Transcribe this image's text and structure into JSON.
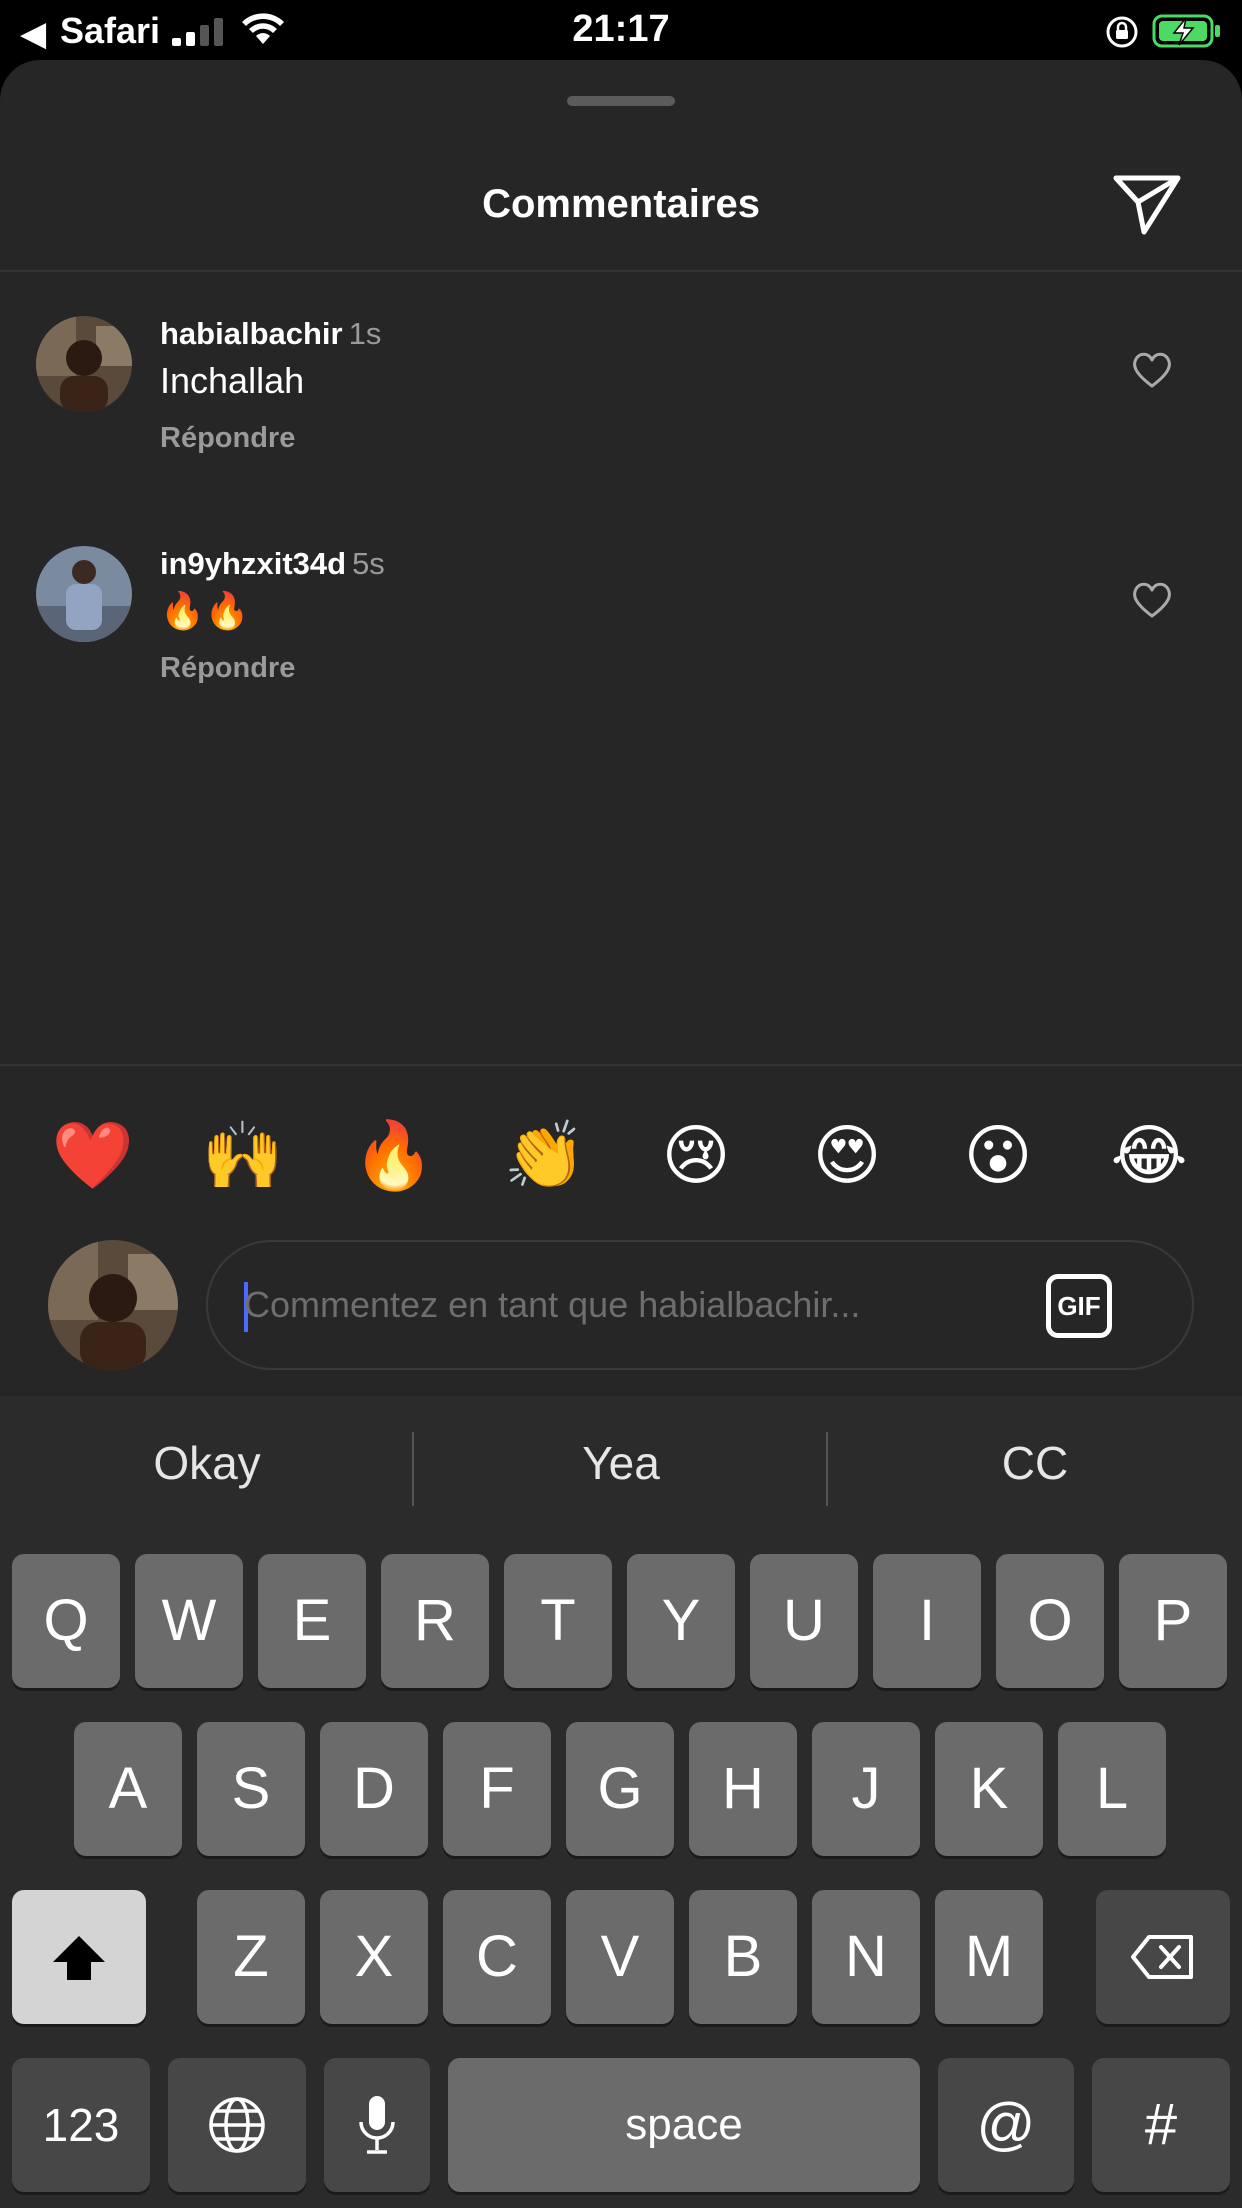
{
  "status_bar": {
    "back_arrow": "◀",
    "app": "Safari",
    "time": "21:17"
  },
  "sheet": {
    "title": "Commentaires"
  },
  "comments": [
    {
      "username": "habialbachir",
      "time": "1s",
      "text": "Inchallah",
      "reply": "Répondre"
    },
    {
      "username": "in9yhzxit34d",
      "time": "5s",
      "text": "🔥🔥",
      "reply": "Répondre"
    }
  ],
  "emojis": [
    "❤️",
    "🙌",
    "🔥",
    "👏",
    "😢",
    "😍",
    "😮",
    "😂"
  ],
  "comment_input": {
    "placeholder": "Commentez en tant que habialbachir...",
    "gif_label": "GIF"
  },
  "keyboard": {
    "suggestions": [
      "Okay",
      "Yea",
      "CC"
    ],
    "row1": [
      "Q",
      "W",
      "E",
      "R",
      "T",
      "Y",
      "U",
      "I",
      "O",
      "P"
    ],
    "row2": [
      "A",
      "S",
      "D",
      "F",
      "G",
      "H",
      "J",
      "K",
      "L"
    ],
    "row3": [
      "Z",
      "X",
      "C",
      "V",
      "B",
      "N",
      "M"
    ],
    "numbers_label": "123",
    "space_label": "space",
    "at_label": "@",
    "hash_label": "#"
  },
  "colors": {
    "background": "#262626",
    "keyboard_bg": "#2b2b2b",
    "key": "#6b6b6b",
    "battery": "#4cd964"
  }
}
